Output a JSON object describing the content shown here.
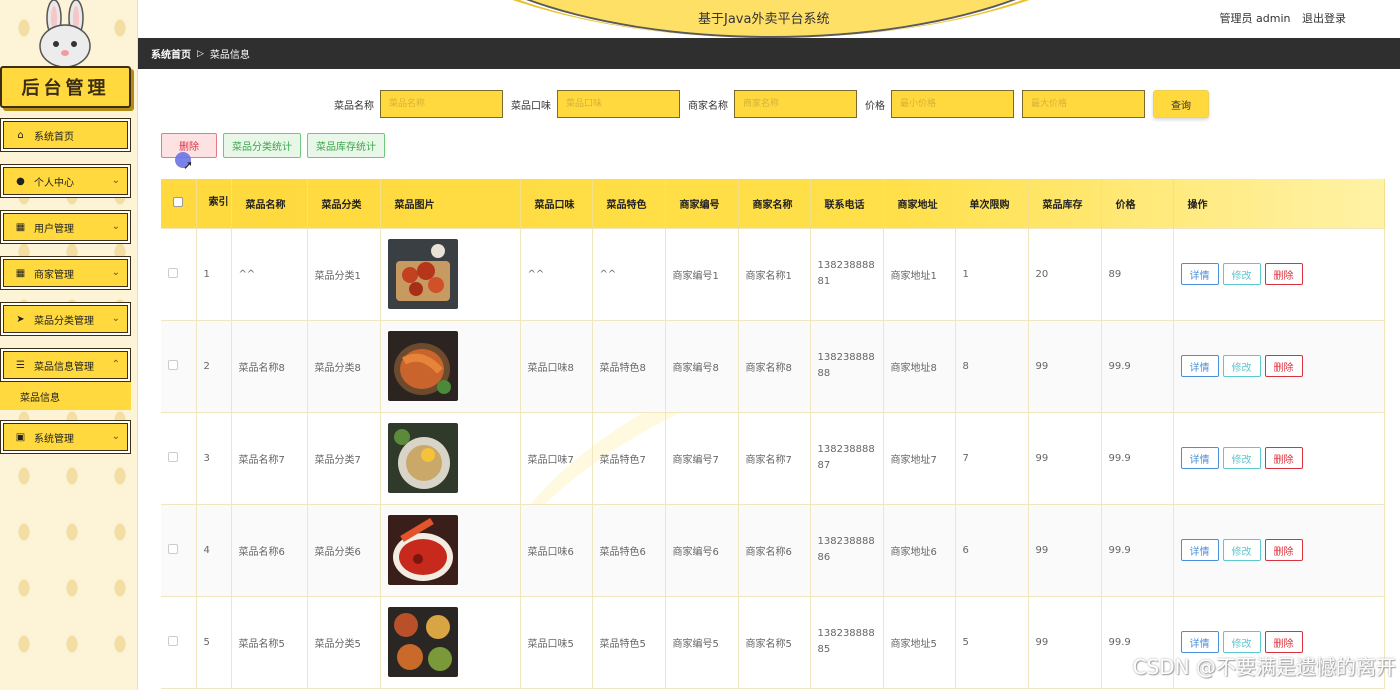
{
  "header": {
    "title": "基于Java外卖平台系统",
    "user_label": "管理员 admin",
    "logout_label": "退出登录"
  },
  "sidebar": {
    "logo_text": "后台管理",
    "items": [
      {
        "label": "系统首页",
        "icon": "home-icon",
        "has_children": false
      },
      {
        "label": "个人中心",
        "icon": "user-icon",
        "has_children": true
      },
      {
        "label": "用户管理",
        "icon": "grid-icon",
        "has_children": true
      },
      {
        "label": "商家管理",
        "icon": "grid-icon",
        "has_children": true
      },
      {
        "label": "菜品分类管理",
        "icon": "send-icon",
        "has_children": true
      },
      {
        "label": "菜品信息管理",
        "icon": "list-icon",
        "has_children": true,
        "expanded": true
      },
      {
        "label": "系统管理",
        "icon": "chart-icon",
        "has_children": true
      }
    ],
    "submenu_active": "菜品信息"
  },
  "breadcrumb": {
    "home": "系统首页",
    "current": "菜品信息"
  },
  "search": {
    "dish_name_label": "菜品名称",
    "dish_name_placeholder": "菜品名称",
    "taste_label": "菜品口味",
    "taste_placeholder": "菜品口味",
    "merchant_label": "商家名称",
    "merchant_placeholder": "商家名称",
    "price_label": "价格",
    "min_price_placeholder": "最小价格",
    "max_price_placeholder": "最大价格",
    "query_label": "查询"
  },
  "actions": {
    "delete_label": "删除",
    "category_stats_label": "菜品分类统计",
    "stock_stats_label": "菜品库存统计"
  },
  "table": {
    "columns": [
      "索引",
      "菜品名称",
      "菜品分类",
      "菜品图片",
      "菜品口味",
      "菜品特色",
      "商家编号",
      "商家名称",
      "联系电话",
      "商家地址",
      "单次限购",
      "菜品库存",
      "价格",
      "操作"
    ],
    "rows": [
      {
        "index": "1",
        "name": "^^",
        "category": "菜品分类1",
        "taste": "^^",
        "feature": "^^",
        "merchant_no": "商家编号1",
        "merchant_name": "商家名称1",
        "phone": "13823888881",
        "address": "商家地址1",
        "limit": "1",
        "stock": "20",
        "price": "89"
      },
      {
        "index": "2",
        "name": "菜品名称8",
        "category": "菜品分类8",
        "taste": "菜品口味8",
        "feature": "菜品特色8",
        "merchant_no": "商家编号8",
        "merchant_name": "商家名称8",
        "phone": "13823888888",
        "address": "商家地址8",
        "limit": "8",
        "stock": "99",
        "price": "99.9"
      },
      {
        "index": "3",
        "name": "菜品名称7",
        "category": "菜品分类7",
        "taste": "菜品口味7",
        "feature": "菜品特色7",
        "merchant_no": "商家编号7",
        "merchant_name": "商家名称7",
        "phone": "13823888887",
        "address": "商家地址7",
        "limit": "7",
        "stock": "99",
        "price": "99.9"
      },
      {
        "index": "4",
        "name": "菜品名称6",
        "category": "菜品分类6",
        "taste": "菜品口味6",
        "feature": "菜品特色6",
        "merchant_no": "商家编号6",
        "merchant_name": "商家名称6",
        "phone": "13823888886",
        "address": "商家地址6",
        "limit": "6",
        "stock": "99",
        "price": "99.9"
      },
      {
        "index": "5",
        "name": "菜品名称5",
        "category": "菜品分类5",
        "taste": "菜品口味5",
        "feature": "菜品特色5",
        "merchant_no": "商家编号5",
        "merchant_name": "商家名称5",
        "phone": "13823888885",
        "address": "商家地址5",
        "limit": "5",
        "stock": "99",
        "price": "99.9"
      }
    ],
    "op_detail": "详情",
    "op_edit": "修改",
    "op_delete": "删除"
  },
  "watermark": "CSDN @不要满是遗憾的离开",
  "colors": {
    "accent": "#ffd93d",
    "dark_bar": "#2f2f2f",
    "danger": "#d9333f",
    "info": "#4a90d9",
    "cyan": "#5cc8d0",
    "success": "#3aa64a"
  }
}
